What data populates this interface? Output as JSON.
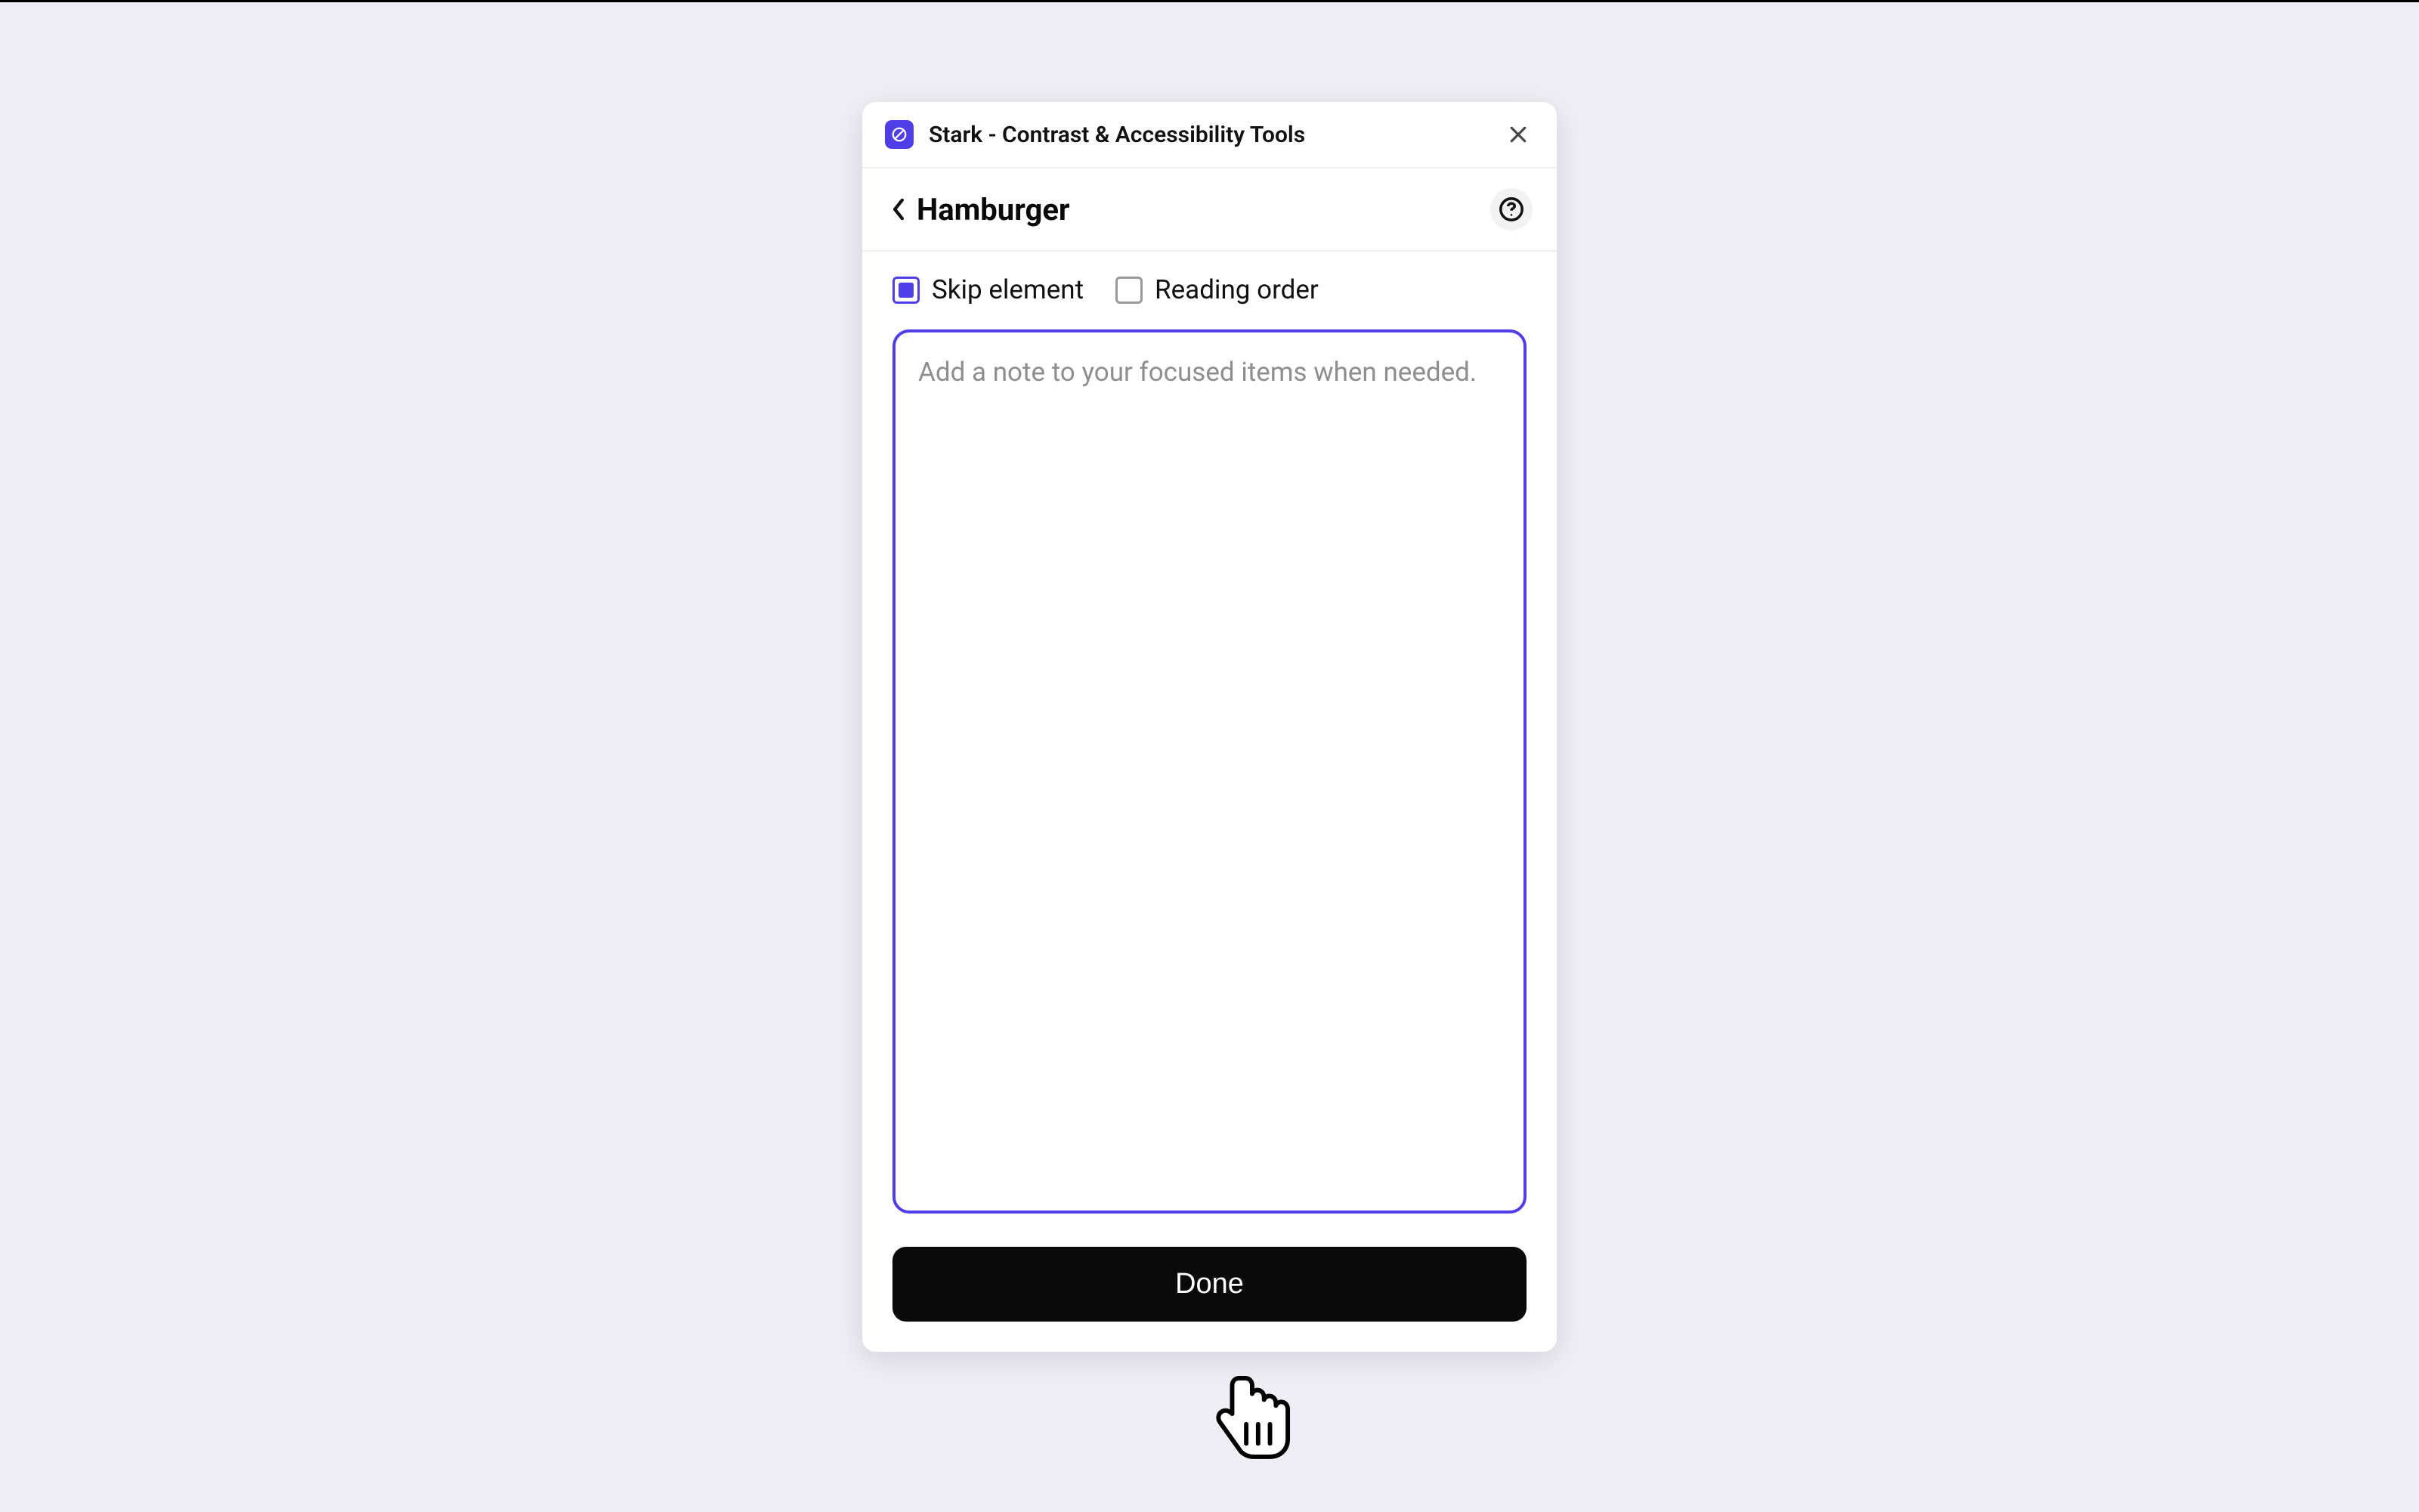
{
  "titlebar": {
    "title": "Stark - Contrast & Accessibility Tools"
  },
  "header": {
    "title": "Hamburger"
  },
  "checkboxes": {
    "skip": {
      "label": "Skip element",
      "checked": true
    },
    "reading_order": {
      "label": "Reading order",
      "checked": false
    }
  },
  "note": {
    "value": "",
    "placeholder": "Add a note to your focused items when needed. "
  },
  "actions": {
    "done": "Done"
  },
  "colors": {
    "accent": "#4f3ee8"
  }
}
